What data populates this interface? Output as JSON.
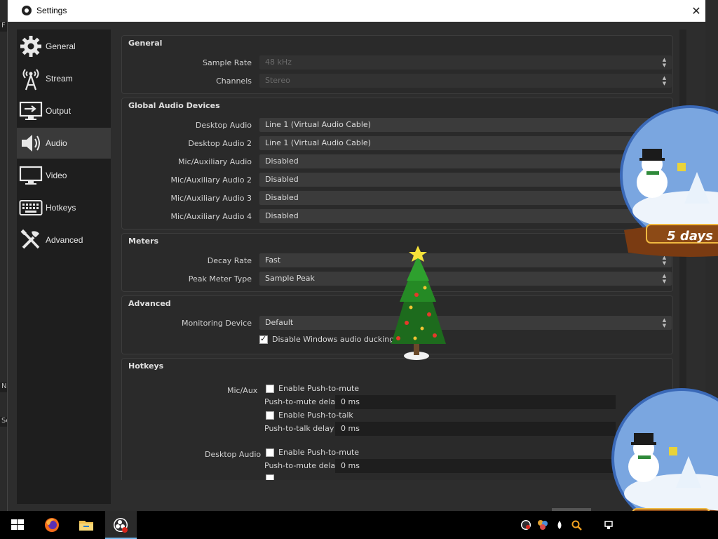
{
  "window": {
    "title": "Settings",
    "close": "✕"
  },
  "background_app": {
    "edge_letters": [
      "F",
      "N",
      "Sc"
    ]
  },
  "sidebar": {
    "items": [
      {
        "label": "General",
        "icon": "gear-icon"
      },
      {
        "label": "Stream",
        "icon": "broadcast-tower-icon"
      },
      {
        "label": "Output",
        "icon": "monitor-arrow-icon"
      },
      {
        "label": "Audio",
        "icon": "speaker-icon",
        "active": true
      },
      {
        "label": "Video",
        "icon": "monitor-icon"
      },
      {
        "label": "Hotkeys",
        "icon": "keyboard-icon"
      },
      {
        "label": "Advanced",
        "icon": "tools-icon"
      }
    ]
  },
  "general": {
    "title": "General",
    "sample_rate": {
      "label": "Sample Rate",
      "value": "48 kHz"
    },
    "channels": {
      "label": "Channels",
      "value": "Stereo"
    }
  },
  "global_audio": {
    "title": "Global Audio Devices",
    "rows": [
      {
        "label": "Desktop Audio",
        "value": "Line 1 (Virtual Audio Cable)"
      },
      {
        "label": "Desktop Audio 2",
        "value": "Line 1 (Virtual Audio Cable)"
      },
      {
        "label": "Mic/Auxiliary Audio",
        "value": "Disabled"
      },
      {
        "label": "Mic/Auxiliary Audio 2",
        "value": "Disabled"
      },
      {
        "label": "Mic/Auxiliary Audio 3",
        "value": "Disabled"
      },
      {
        "label": "Mic/Auxiliary Audio 4",
        "value": "Disabled"
      }
    ]
  },
  "meters": {
    "title": "Meters",
    "decay_rate": {
      "label": "Decay Rate",
      "value": "Fast"
    },
    "peak_meter_type": {
      "label": "Peak Meter Type",
      "value": "Sample Peak"
    }
  },
  "advanced": {
    "title": "Advanced",
    "monitoring_device": {
      "label": "Monitoring Device",
      "value": "Default"
    },
    "disable_ducking": {
      "label": "Disable Windows audio ducking",
      "checked": true
    }
  },
  "hotkeys": {
    "title": "Hotkeys",
    "mic_aux": {
      "label": "Mic/Aux",
      "push_to_mute": "Enable Push-to-mute",
      "push_to_mute_delay_label": "Push-to-mute delay",
      "push_to_mute_delay": "0 ms",
      "push_to_talk": "Enable Push-to-talk",
      "push_to_talk_delay_label": "Push-to-talk delay",
      "push_to_talk_delay": "0 ms"
    },
    "desktop_audio": {
      "label": "Desktop Audio",
      "push_to_mute": "Enable Push-to-mute",
      "push_to_mute_delay_label": "Push-to-mute delay",
      "push_to_mute_delay": "0 ms"
    }
  },
  "overlays": {
    "globe_banner": "5 days"
  },
  "taskbar": {
    "apps": [
      "windows-start-icon",
      "firefox-icon",
      "file-explorer-icon",
      "obs-icon"
    ],
    "tray": [
      "obs-tray-icon",
      "app-tray-icon",
      "drop-tray-icon",
      "search-tray-icon",
      "network-tray-icon"
    ]
  },
  "colors": {
    "accent": "#76b9ed",
    "panel": "#2d2d2d",
    "sidebar": "#1e1e1e",
    "active_item": "#3a3a3a"
  }
}
